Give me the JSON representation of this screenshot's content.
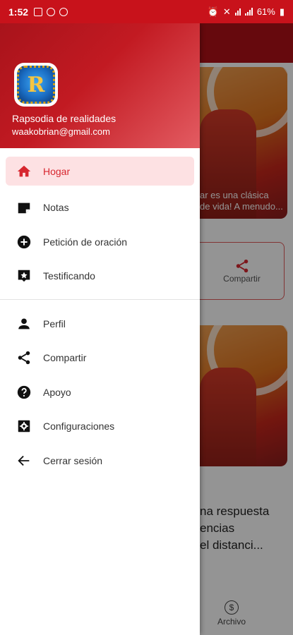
{
  "status_bar": {
    "time": "1:52",
    "battery": "61%"
  },
  "drawer": {
    "user_name": "Rapsodia de realidades",
    "user_email": "waakobrian@gmail.com",
    "primary_items": [
      {
        "label": "Hogar",
        "icon": "home-icon",
        "active": true
      },
      {
        "label": "Notas",
        "icon": "note-icon"
      },
      {
        "label": "Petición de oración",
        "icon": "add-circle-icon"
      },
      {
        "label": "Testificando",
        "icon": "testimony-icon"
      }
    ],
    "secondary_items": [
      {
        "label": "Perfil",
        "icon": "person-icon"
      },
      {
        "label": "Compartir",
        "icon": "share-icon"
      },
      {
        "label": "Apoyo",
        "icon": "help-icon"
      },
      {
        "label": "Configuraciones",
        "icon": "settings-icon"
      },
      {
        "label": "Cerrar sesión",
        "icon": "arrow-back-icon"
      }
    ]
  },
  "background": {
    "card_text_1": "ar es una clásica",
    "card_text_2": "de vida! A menudo...",
    "share_label": "Compartir",
    "article_title_1": "na respuesta",
    "article_title_2": "encias",
    "article_title_3": "el distanci...",
    "bottom_label": "Archivo"
  },
  "colors": {
    "brand_red": "#c8121b",
    "active_bg": "#fde1e3",
    "active_text": "#d7262f"
  }
}
